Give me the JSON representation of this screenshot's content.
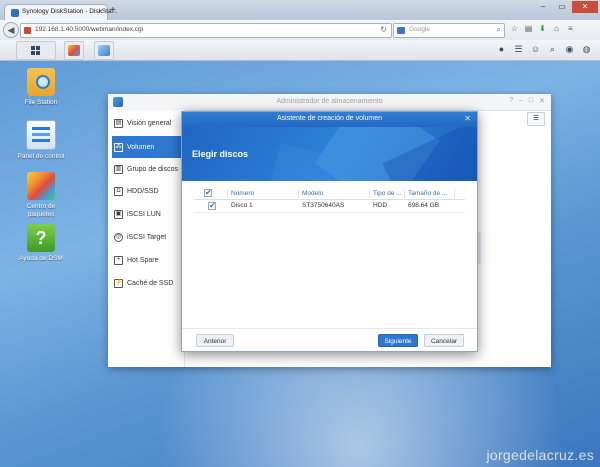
{
  "browser": {
    "tab_title": "Synology DiskStation - DiskSta...",
    "tab_close": "×",
    "new_tab": "+",
    "url": "192.168.1.40:5000/webman/index.cgi",
    "search_placeholder": "Google",
    "window_controls": [
      "–",
      "▭",
      "✕"
    ]
  },
  "taskbar": {
    "apps": [
      "package-center",
      "storage-manager"
    ]
  },
  "desktop": {
    "icons": [
      {
        "label": "File Station",
        "icon": "folder-search-icon"
      },
      {
        "label": "Panel de control",
        "icon": "control-panel-icon"
      },
      {
        "label": "Centro de paquetes",
        "icon": "package-center-icon"
      },
      {
        "label": "Ayuda de DSM",
        "icon": "help-book-icon"
      }
    ]
  },
  "storage_manager": {
    "title": "Administrador de almacenamiento",
    "sidebar": [
      {
        "label": "Visión general",
        "icon": "overview-icon",
        "active": false
      },
      {
        "label": "Volumen",
        "icon": "volume-icon",
        "active": true
      },
      {
        "label": "Grupo de discos",
        "icon": "disk-group-icon",
        "active": false
      },
      {
        "label": "HDD/SSD",
        "icon": "hdd-icon",
        "active": false
      },
      {
        "label": "iSCSI LUN",
        "icon": "iscsi-lun-icon",
        "active": false
      },
      {
        "label": "iSCSI Target",
        "icon": "iscsi-target-icon",
        "active": false
      },
      {
        "label": "Hot Spare",
        "icon": "hot-spare-icon",
        "active": false
      },
      {
        "label": "Caché de SSD",
        "icon": "ssd-cache-icon",
        "active": false
      }
    ]
  },
  "wizard": {
    "title": "Asistente de creación de volumen",
    "heading": "Elegir discos",
    "columns": [
      "Número",
      "Modelo",
      "Tipo de ...",
      "Tamaño de ..."
    ],
    "rows": [
      {
        "checked": true,
        "number": "Disco 1",
        "model": "ST3750640AS",
        "type": "HDD",
        "size": "698.64 GB"
      }
    ],
    "buttons": {
      "back": "Anterior",
      "next": "Siguiente",
      "cancel": "Cancelar"
    },
    "close": "✕"
  },
  "watermark": "jorgedelacruz.es",
  "colors": {
    "accent": "#2e78d2",
    "close": "#c94c3d"
  }
}
